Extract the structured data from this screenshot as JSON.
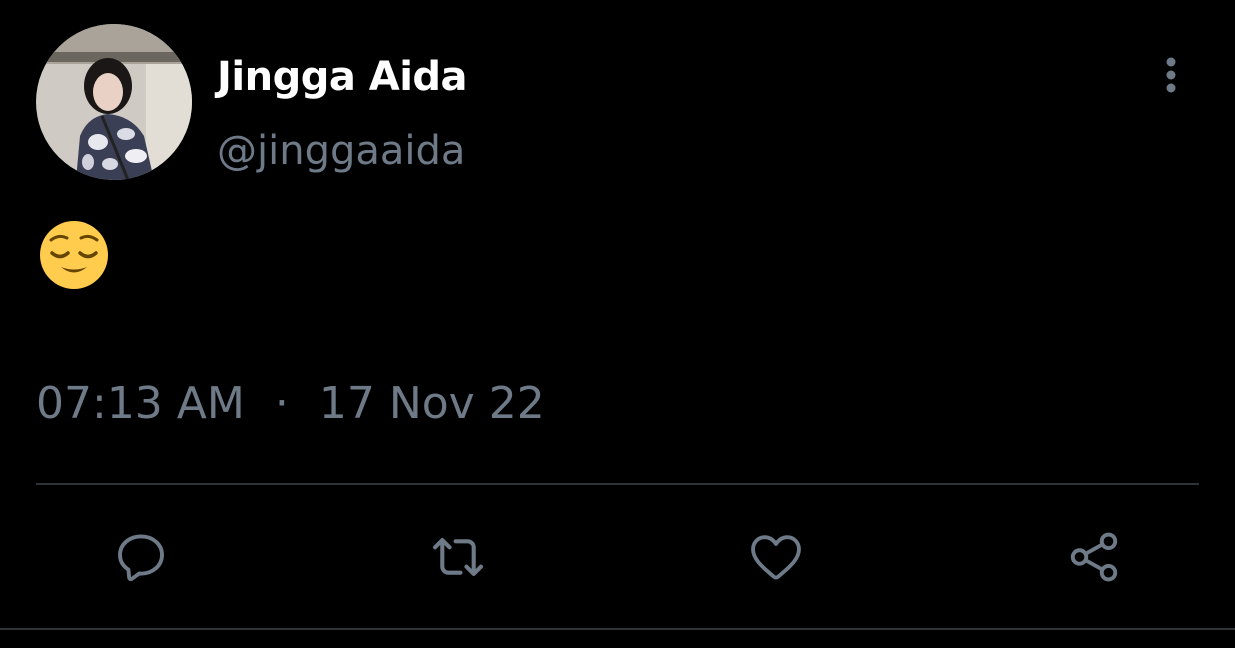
{
  "tweet": {
    "author": {
      "display_name": "Jingga Aida",
      "handle": "@jinggaaida"
    },
    "content": {
      "emoji": "relieved-face"
    },
    "time": "07:13 AM",
    "separator": "·",
    "date": "17 Nov 22"
  },
  "actions": [
    {
      "name": "reply",
      "icon": "reply-icon"
    },
    {
      "name": "retweet",
      "icon": "retweet-icon"
    },
    {
      "name": "like",
      "icon": "heart-icon"
    },
    {
      "name": "share",
      "icon": "share-icon"
    }
  ],
  "colors": {
    "background": "#000000",
    "primary_text": "#ffffff",
    "secondary_text": "#6e7a87",
    "icon": "#6e7a87",
    "divider": "#2f3336"
  }
}
